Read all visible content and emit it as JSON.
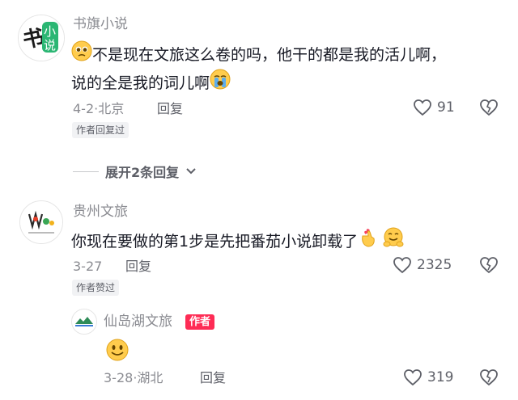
{
  "comments": [
    {
      "user": "书旗小说",
      "avatar_text": "书小说",
      "text_line1": "不是现在文旅这么卷的吗，他干的都是我的活儿啊，",
      "text_line2": "说的全是我的词儿啊",
      "date": "4-2",
      "location": "北京",
      "reply_label": "回复",
      "likes": "91",
      "tag": "作者回复过",
      "expand_label": "展开2条回复"
    },
    {
      "user": "贵州文旅",
      "text": "你现在要做的第1步是先把番茄小说卸载了",
      "date": "3-27",
      "reply_label": "回复",
      "likes": "2325",
      "tag": "作者赞过"
    },
    {
      "user": "仙岛湖文旅",
      "badge": "作者",
      "date": "3-28",
      "location": "湖北",
      "reply_label": "回复",
      "likes": "319"
    }
  ],
  "icons": {
    "like": "heart-outline-icon",
    "dislike": "broken-heart-icon",
    "expand": "chevron-down-icon",
    "emoji_pleading": "pleading-face-emoji",
    "emoji_crying": "loudly-crying-face-emoji",
    "emoji_finger_heart": "finger-heart-emoji",
    "emoji_hug": "hugging-face-emoji",
    "emoji_smile": "smiling-face-emoji"
  },
  "colors": {
    "text_primary": "#161823",
    "text_secondary": "#8a8b91",
    "author_badge": "#fe2c55"
  }
}
